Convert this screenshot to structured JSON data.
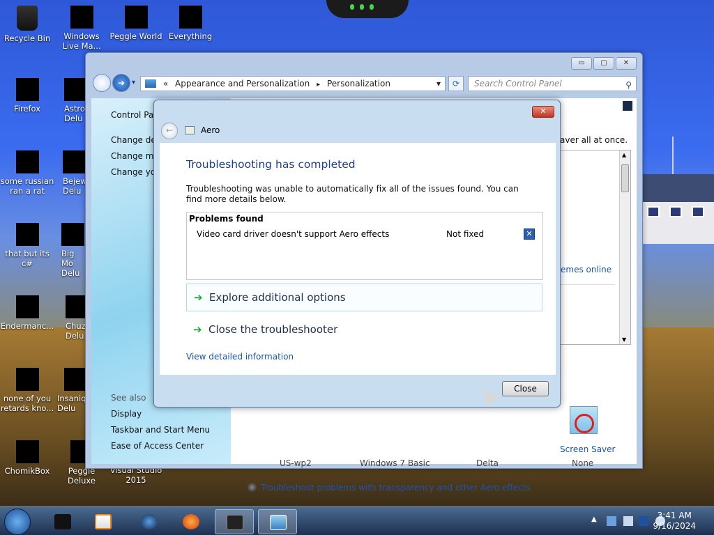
{
  "desktop": {
    "icons": [
      {
        "label": "Recycle Bin"
      },
      {
        "label": "Windows Live Ma..."
      },
      {
        "label": "Peggle World"
      },
      {
        "label": "Everything"
      },
      {
        "label": "Firefox"
      },
      {
        "label": "Astrol Delu"
      },
      {
        "label": "some russian ran a rat"
      },
      {
        "label": "Bejew Delu"
      },
      {
        "label": "that but its c#"
      },
      {
        "label": "Big Mo Delu"
      },
      {
        "label": "Endermanc..."
      },
      {
        "label": "Chuz Delu"
      },
      {
        "label": "none of you retards kno..."
      },
      {
        "label": "Insaniq Delu"
      },
      {
        "label": "ChomikBox"
      },
      {
        "label": "Peggle Deluxe"
      },
      {
        "label": "Visual Studio 2015"
      }
    ]
  },
  "explorer": {
    "window_buttons": {
      "minimize": "▭",
      "maximize": "▢",
      "close": "✕"
    },
    "address": {
      "prefix": "«",
      "crumb1": "Appearance and Personalization",
      "sep": "▸",
      "crumb2": "Personalization",
      "dropdown": "▾"
    },
    "search_placeholder": "Search Control Panel",
    "left_pane": {
      "control_panel": "Control Par",
      "links": [
        "Change des",
        "Change mo",
        "Change you"
      ],
      "see_also": "See also",
      "see_also_links": [
        "Display",
        "Taskbar and Start Menu",
        "Ease of Access Center"
      ]
    },
    "partial_text": "aver all at once.",
    "themes_online": "emes online",
    "screen_saver": "Screen Saver",
    "screen_saver_value": "None",
    "themes": [
      "US-wp2",
      "Windows 7 Basic",
      "Delta"
    ],
    "troubleshoot_link": "Troubleshoot problems with transparency and other Aero effects"
  },
  "dialog": {
    "title": "Aero",
    "close_glyph": "✕",
    "heading": "Troubleshooting has completed",
    "description": "Troubleshooting was unable to automatically fix all of the issues found. You can find more details below.",
    "problems_header": "Problems found",
    "problem_name": "Video card driver doesn't support Aero effects",
    "problem_status": "Not fixed",
    "option_explore": "Explore additional options",
    "option_close": "Close the troubleshooter",
    "detail_link": "View detailed information",
    "close_button": "Close"
  },
  "taskbar": {
    "time": "3:41 AM",
    "date": "9/16/2024",
    "tray_chevron": "▲"
  }
}
